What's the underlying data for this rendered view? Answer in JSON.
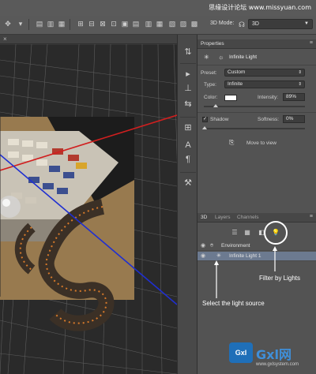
{
  "watermark_top": "思缘设计论坛 www.missyuan.com",
  "options_bar": {
    "mode_label": "3D Mode:",
    "workspace_select": "3D"
  },
  "properties_panel": {
    "tab": "Properties",
    "type_header": "Infinite Light",
    "preset_label": "Preset:",
    "preset_value": "Custom",
    "type_label": "Type:",
    "type_value": "Infinite",
    "color_label": "Color:",
    "color_value": "#ffffff",
    "intensity_label": "Intensity:",
    "intensity_value": "89%",
    "shadow_label": "Shadow",
    "shadow_checked": "✓",
    "softness_label": "Softness:",
    "softness_value": "0%",
    "move_to_view": "Move to view"
  },
  "panel_3d": {
    "tabs": [
      "3D",
      "Layers",
      "Channels"
    ],
    "layers": [
      {
        "name": "Environment",
        "selected": false
      },
      {
        "name": "Infinite Light 1",
        "selected": true
      }
    ]
  },
  "annotations": {
    "filter_by_lights": "Filter by Lights",
    "select_light_source": "Select the light source"
  },
  "watermark_bottom": {
    "logo": "Gxl",
    "name": "Gxl网",
    "url": "www.gxlsystem.com"
  },
  "icons": {
    "light": "sun-light-icon",
    "eye": "eye-icon"
  }
}
